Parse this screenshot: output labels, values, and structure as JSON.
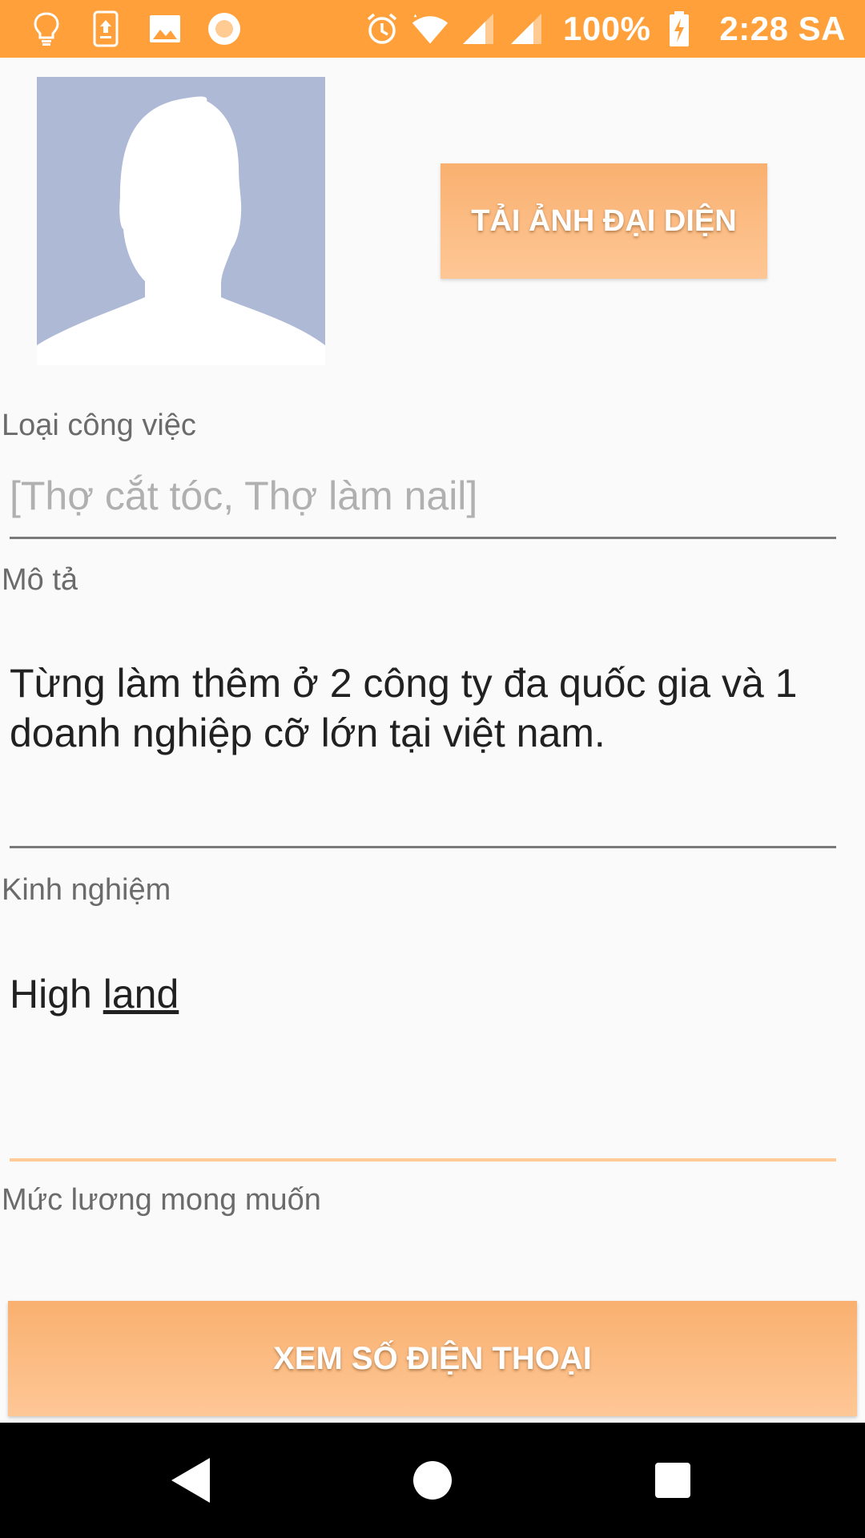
{
  "status_bar": {
    "battery": "100%",
    "time": "2:28 SA",
    "background_color": "#ffa03a",
    "left_icons": [
      "lightbulb-icon",
      "phone-update-icon",
      "image-icon",
      "record-icon"
    ],
    "right_icons": [
      "alarm-icon",
      "wifi-icon",
      "signal-icon",
      "signal-icon",
      "battery-charging-icon"
    ]
  },
  "profile": {
    "upload_avatar_label": "TẢI ẢNH ĐẠI DIỆN"
  },
  "form": {
    "job_type": {
      "label": "Loại công việc",
      "placeholder": "[Thợ cắt tóc, Thợ làm nail]"
    },
    "description": {
      "label": "Mô tả",
      "value": "Từng làm thêm ở 2 công ty đa quốc gia và 1 doanh nghiệp cỡ lớn tại việt nam."
    },
    "experience": {
      "label": "Kinh nghiệm",
      "value_part1": "High ",
      "value_part2": "land"
    },
    "salary": {
      "label": "Mức lương mong muốn"
    }
  },
  "actions": {
    "view_phone_label": "XEM SỐ ĐIỆN THOẠI"
  },
  "colors": {
    "accent": "#ffa03a",
    "button_top": "#f9b06f",
    "button_bottom": "#fec796",
    "focused_underline": "#ffcc99"
  }
}
